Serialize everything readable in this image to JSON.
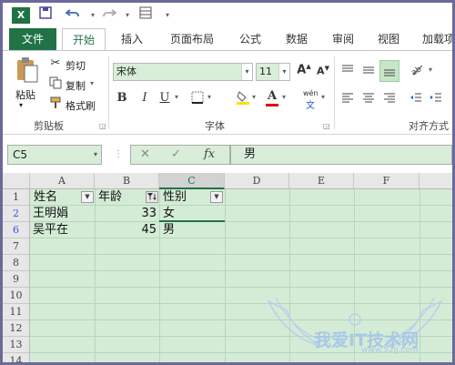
{
  "qat": {
    "excel_icon": "excel-logo-icon",
    "icons": [
      "save-icon",
      "undo-icon",
      "redo-icon",
      "form-icon",
      "customize-icon"
    ]
  },
  "tabs": [
    {
      "label": "文件"
    },
    {
      "label": "开始"
    },
    {
      "label": "插入"
    },
    {
      "label": "页面布局"
    },
    {
      "label": "公式"
    },
    {
      "label": "数据"
    },
    {
      "label": "审阅"
    },
    {
      "label": "视图"
    },
    {
      "label": "加载项"
    }
  ],
  "clipboard": {
    "paste_label": "粘贴",
    "cut_label": "剪切",
    "copy_label": "复制",
    "format_painter_label": "格式刷",
    "group_label": "剪贴板"
  },
  "font": {
    "font_name": "宋体",
    "font_size": "11",
    "bold": "B",
    "italic": "I",
    "underline": "U",
    "grow": "A",
    "shrink": "A",
    "phonetic": "wén",
    "phonetic_sub": "文",
    "group_label": "字体"
  },
  "alignment": {
    "group_label": "对齐方式"
  },
  "formula_bar": {
    "name_box": "C5",
    "cancel": "✕",
    "enter": "✓",
    "fx": "fx",
    "formula": "男"
  },
  "grid": {
    "columns": [
      "A",
      "B",
      "C",
      "D",
      "E",
      "F"
    ],
    "rows": [
      "1",
      "2",
      "6",
      "7",
      "8",
      "9",
      "10",
      "11",
      "12",
      "13",
      "14"
    ],
    "header_row": [
      "姓名",
      "年龄",
      "性别"
    ],
    "data_rows": [
      [
        "王明娟",
        "33",
        "女"
      ],
      [
        "吴平在",
        "45",
        "男"
      ]
    ]
  },
  "watermark": {
    "text": "我爱IT技术网",
    "url": "www.52ij.com"
  },
  "colors": {
    "accent": "#217346",
    "cell_bg": "#d4ecd6",
    "filtered_row": "#2a5bd7"
  }
}
